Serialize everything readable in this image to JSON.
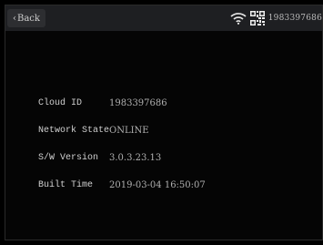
{
  "header": {
    "back_label": "Back",
    "device_id": "1983397686",
    "icons": [
      "back-chevron-icon",
      "wifi-icon",
      "qr-code-icon"
    ]
  },
  "info": [
    {
      "label": "Cloud ID",
      "value": "1983397686"
    },
    {
      "label": "Network State",
      "value": "ONLINE"
    },
    {
      "label": "S/W Version",
      "value": "3.0.3.23.13"
    },
    {
      "label": "Built Time",
      "value": "2019-03-04 16:50:07"
    }
  ]
}
